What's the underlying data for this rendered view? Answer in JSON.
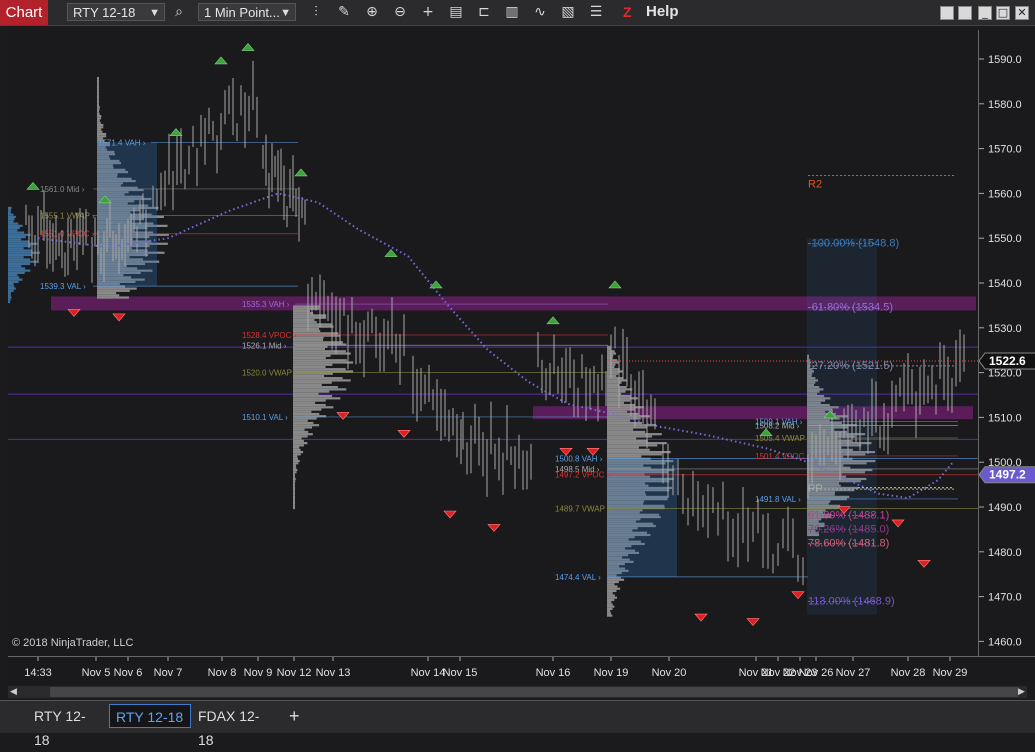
{
  "toolbar": {
    "chart_label": "Chart",
    "instrument": "RTY 12-18",
    "interval": "1 Min Point...",
    "help_label": "Help",
    "z_label": "Z"
  },
  "price_axis": {
    "ticks": [
      "1590.0",
      "1580.0",
      "1570.0",
      "1560.0",
      "1550.0",
      "1540.0",
      "1530.0",
      "1520.0",
      "1510.0",
      "1500.0",
      "1490.0",
      "1480.0",
      "1470.0",
      "1460.0"
    ],
    "last_price": "1522.6",
    "alt_price": "1497.2",
    "last_color": "#ffffff",
    "alt_color": "#6a5acd"
  },
  "x_axis": {
    "labels": [
      "14:33",
      "Nov 5",
      "Nov 6",
      "Nov 7",
      "Nov 8",
      "Nov 9",
      "Nov 12",
      "Nov 13",
      "Nov 14",
      "Nov 15",
      "Nov 16",
      "Nov 19",
      "Nov 20",
      "Nov 21",
      "Nov 22",
      "Nov 23",
      "Nov 26",
      "Nov 27",
      "Nov 28",
      "Nov 29"
    ]
  },
  "profile_labels": [
    {
      "text": "1571.4 VAH",
      "color": "#5aa0e8"
    },
    {
      "text": "1561.0 Mid",
      "color": "#888"
    },
    {
      "text": "1555.1 VWAP",
      "color": "#8a8a3a"
    },
    {
      "text": "1551.0 VPOC",
      "color": "#e03030"
    },
    {
      "text": "1539.3 VAL",
      "color": "#5aa0e8"
    },
    {
      "text": "1535.3 VAH",
      "color": "#9a6ad8"
    },
    {
      "text": "1528.4 VPOC",
      "color": "#e03030"
    },
    {
      "text": "1526.1 Mid",
      "color": "#aaa"
    },
    {
      "text": "1520.0 VWAP",
      "color": "#8a8a3a"
    },
    {
      "text": "1510.1 VAL",
      "color": "#5aa0e8"
    },
    {
      "text": "1500.8 VAH",
      "color": "#5aa0e8"
    },
    {
      "text": "1498.5 Mid",
      "color": "#aaa"
    },
    {
      "text": "1497.2 VPOC",
      "color": "#e03030"
    },
    {
      "text": "1489.7 VWAP",
      "color": "#8a8a3a"
    },
    {
      "text": "1474.4 VAL",
      "color": "#5aa0e8"
    },
    {
      "text": "1509.1 VAH",
      "color": "#5aa0e8"
    },
    {
      "text": "1508.2 Mid",
      "color": "#aaa"
    },
    {
      "text": "1505.4 VWAP",
      "color": "#8a8a3a"
    },
    {
      "text": "1501.4 VPOC",
      "color": "#e03030"
    },
    {
      "text": "1491.8 VAL",
      "color": "#5aa0e8"
    }
  ],
  "fib_labels": [
    {
      "text": "R2",
      "color": "#e8551c"
    },
    {
      "text": "-100.00% (1548.8)",
      "color": "#3a7bc0"
    },
    {
      "text": "-61.80% (1534.5)",
      "color": "#9a6ad8"
    },
    {
      "text": "-27.20% (1521.5)",
      "color": "#8888aa"
    },
    {
      "text": "PP",
      "color": "#aaaaaa"
    },
    {
      "text": "61.80% (1488.1)",
      "color": "#c04090"
    },
    {
      "text": "70.26% (1485.0)",
      "color": "#8a3a8a"
    },
    {
      "text": "78.60% (1481.8)",
      "color": "#d0607a"
    },
    {
      "text": "113.00% (1468.9)",
      "color": "#7a5acd"
    }
  ],
  "copyright": "© 2018 NinjaTrader, LLC",
  "tabs": [
    {
      "label": "RTY 12-18",
      "active": false
    },
    {
      "label": "RTY 12-18",
      "active": true
    },
    {
      "label": "FDAX 12-18",
      "active": false
    }
  ],
  "add_tab_label": "+"
}
